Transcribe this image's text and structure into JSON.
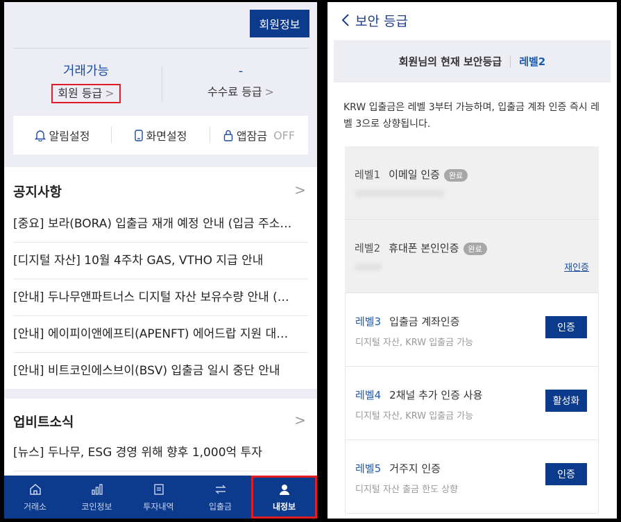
{
  "left": {
    "member_info_button": "회원정보",
    "trade_status": "거래가능",
    "member_grade_label": "회원 등급",
    "fee_value": "-",
    "fee_grade_label": "수수료 등급",
    "chevron": ">",
    "settings": {
      "alarm": "알림설정",
      "screen": "화면설정",
      "app_lock": "앱잠금",
      "app_lock_state": "OFF"
    },
    "notice": {
      "title": "공지사항",
      "items": [
        "[중요] 보라(BORA) 입출금 재개 예정 안내 (입금 주소…",
        "[디지털 자산] 10월 4주차 GAS, VTHO 지급 안내",
        "[안내] 두나무앤파트너스 디지털 자산 보유수량 안내 (…",
        "[안내] 에이피이앤에프티(APENFT) 에어드랍 지원 대…",
        "[안내] 비트코인에스브이(BSV) 입출금 일시 중단 안내"
      ]
    },
    "news": {
      "title": "업비트소식",
      "items": [
        "[뉴스] 두나무, ESG 경영 위해 향후 1,000억 투자"
      ]
    },
    "nav": [
      "거래소",
      "코인정보",
      "투자내역",
      "입출금",
      "내정보"
    ]
  },
  "right": {
    "header_title": "보안 등급",
    "back_icon": "chevron-left-icon",
    "banner_current": "회원님의 현재 보안등급",
    "banner_level": "레벨2",
    "description": "KRW 입출금은 레벨 3부터 가능하며, 입출금 계좌 인증 즉시 레벨 3으로 상향됩니다.",
    "levels": [
      {
        "name": "레벨1",
        "text": "이메일 인증",
        "badge": "완료"
      },
      {
        "name": "레벨2",
        "text": "휴대폰 본인인증",
        "badge": "완료",
        "link": "재인증"
      },
      {
        "name": "레벨3",
        "text": "입출금 계좌인증",
        "sub": "디지털 자산, KRW 입출금 가능",
        "button": "인증"
      },
      {
        "name": "레벨4",
        "text": "2채널 추가 인증 사용",
        "sub": "디지털 자산, KRW 입출금 가능",
        "button": "활성화"
      },
      {
        "name": "레벨5",
        "text": "거주지 인증",
        "sub": "디지털 자산 출금 한도 상향",
        "button": "인증"
      }
    ]
  },
  "colors": {
    "brand": "#0c3a8d",
    "highlight": "#e01c24",
    "link_blue": "#1a5bb8"
  }
}
